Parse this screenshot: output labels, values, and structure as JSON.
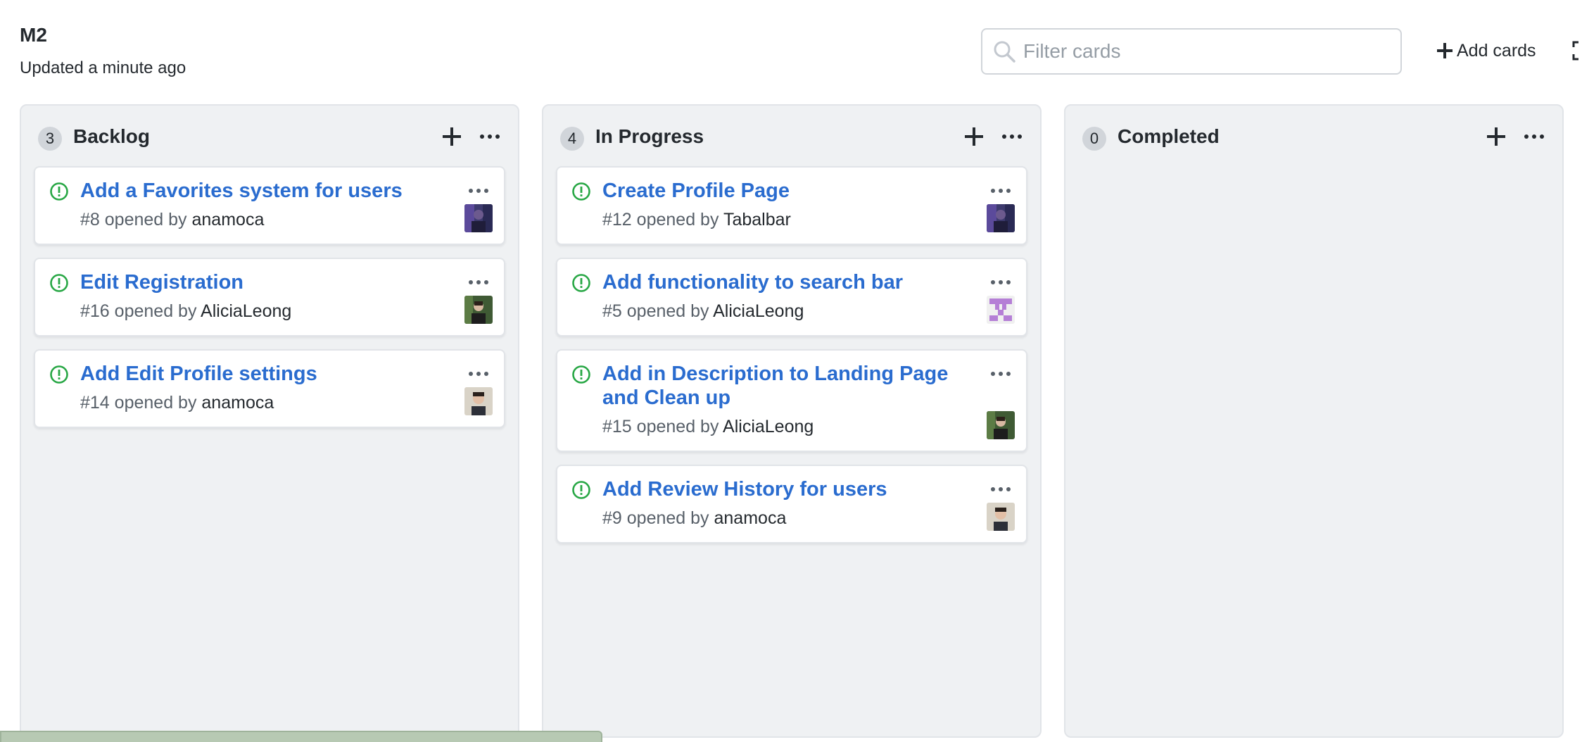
{
  "board": {
    "title": "M2",
    "updated": "Updated a minute ago"
  },
  "filter": {
    "placeholder": "Filter cards",
    "value": ""
  },
  "toolbar": {
    "add_cards_label": "Add cards"
  },
  "colors": {
    "accent_link": "#2a6ccf",
    "open_issue_green": "#28a745",
    "column_bg": "#eff1f3"
  },
  "columns": [
    {
      "count": "3",
      "name": "Backlog",
      "cards": [
        {
          "title": "Add a Favorites system for users",
          "number": "#8",
          "opened_by": "opened by",
          "author": "anamoca",
          "avatar": "avatar-purple"
        },
        {
          "title": "Edit Registration",
          "number": "#16",
          "opened_by": "opened by",
          "author": "AliciaLeong",
          "avatar": "avatar-green"
        },
        {
          "title": "Add Edit Profile settings",
          "number": "#14",
          "opened_by": "opened by",
          "author": "anamoca",
          "avatar": "avatar-face"
        }
      ]
    },
    {
      "count": "4",
      "name": "In Progress",
      "cards": [
        {
          "title": "Create Profile Page",
          "number": "#12",
          "opened_by": "opened by",
          "author": "Tabalbar",
          "avatar": "avatar-purple"
        },
        {
          "title": "Add functionality to search bar",
          "number": "#5",
          "opened_by": "opened by",
          "author": "AliciaLeong",
          "avatar": "avatar-identicon"
        },
        {
          "title": "Add in Description to Landing Page and Clean up",
          "number": "#15",
          "opened_by": "opened by",
          "author": "AliciaLeong",
          "avatar": "avatar-green"
        },
        {
          "title": "Add Review History for users",
          "number": "#9",
          "opened_by": "opened by",
          "author": "anamoca",
          "avatar": "avatar-face"
        }
      ]
    },
    {
      "count": "0",
      "name": "Completed",
      "cards": []
    }
  ]
}
